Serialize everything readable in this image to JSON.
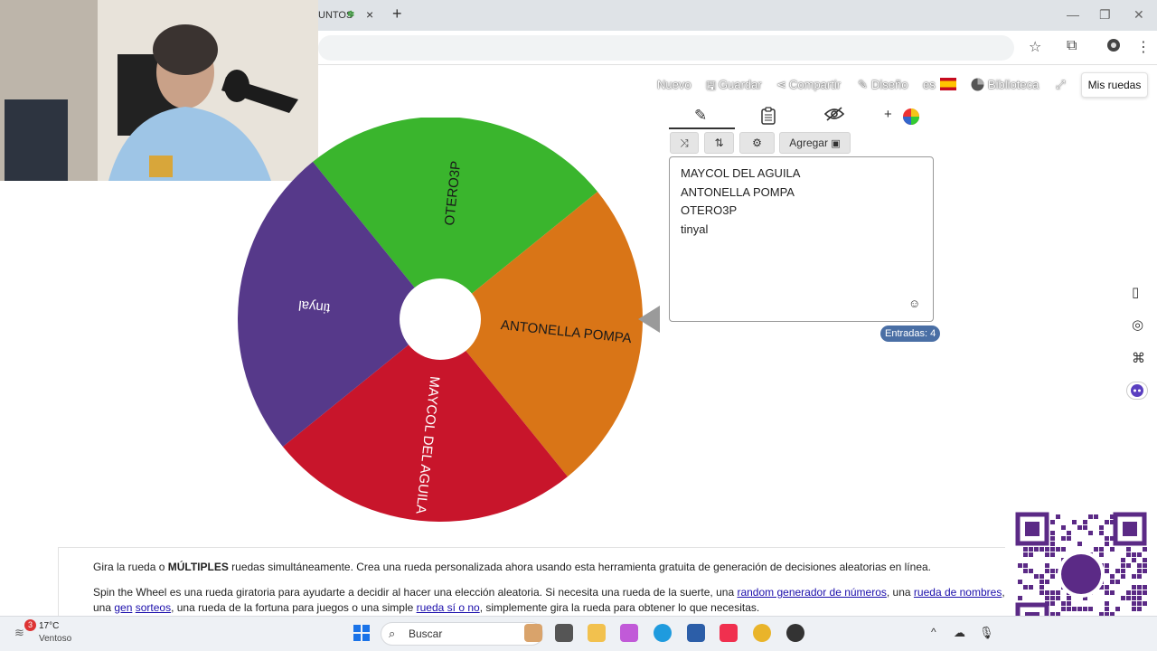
{
  "browser": {
    "tab_title": "UNTOS",
    "tab_close": "×",
    "new_tab": "+",
    "window_controls": [
      "—",
      "❐",
      "✕"
    ]
  },
  "nav": {
    "nuevo": "Nuevo",
    "guardar": "Guardar",
    "compartir": "Compartir",
    "diseno": "Diseño",
    "language": "es",
    "biblioteca": "Biblioteca",
    "mis_ruedas": "Mis ruedas"
  },
  "wheel": {
    "segments": [
      {
        "label": "OTERO3P",
        "color": "#3ab52d"
      },
      {
        "label": "ANTONELLA POMPA",
        "color": "#d97517"
      },
      {
        "label": "MAYCOL DEL AGUILA",
        "color": "#c8152b"
      },
      {
        "label": "tinyal",
        "color": "#56398a"
      }
    ]
  },
  "editor": {
    "add_label": "Agregar",
    "entries": [
      "MAYCOL DEL AGUILA",
      "ANTONELLA POMPA",
      "OTERO3P",
      "tinyal"
    ],
    "entries_badge": "Entradas: 4"
  },
  "description": {
    "p1_a": "Gira la rueda o ",
    "p1_bold": "MÚLTIPLES",
    "p1_b": " ruedas simultáneamente. Crea una rueda personalizada ahora usando esta herramienta gratuita de generación de decisiones aleatorias en línea.",
    "p2_a": "Spin the Wheel es una rueda giratoria para ayudarte a decidir al hacer una elección aleatoria. Si necesita una rueda de la suerte, una ",
    "link1": "random generador de números",
    "p2_b": ", una ",
    "link2": "rueda de nombres",
    "p2_c": ", una ",
    "link3": "gen",
    "p2_d": " ",
    "link4": "sorteos",
    "p2_e": ", una rueda de la fortuna para juegos o una simple ",
    "link5": "rueda sí o no",
    "p2_f": ", simplemente gira la rueda para obtener lo que necesitas."
  },
  "taskbar": {
    "weather_badge": "3",
    "temperature": "17°C",
    "condition": "Ventoso",
    "search_placeholder": "Buscar"
  }
}
